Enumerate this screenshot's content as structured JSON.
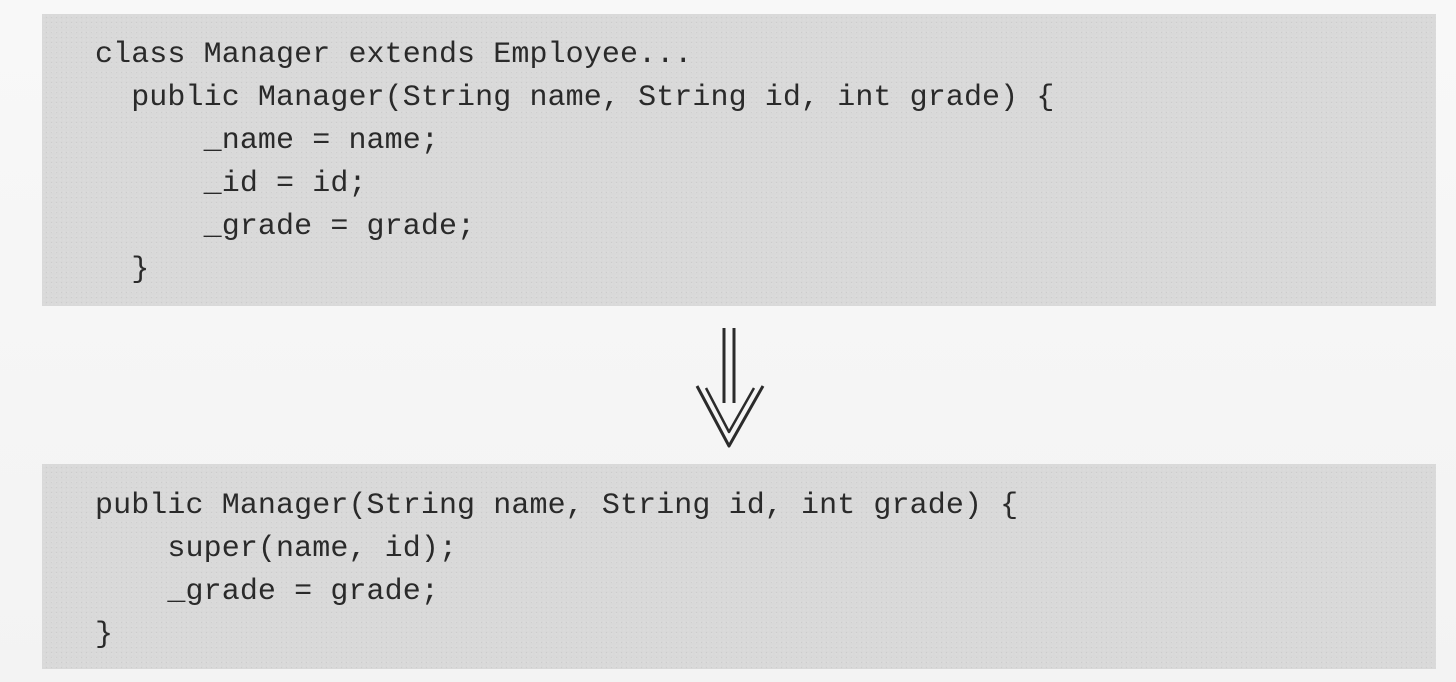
{
  "before_code": {
    "lines": [
      "class Manager extends Employee...",
      "  public Manager(String name, String id, int grade) {",
      "      _name = name;",
      "      _id = id;",
      "      _grade = grade;",
      "  }"
    ]
  },
  "transition": {
    "icon": "double-down-arrow-icon"
  },
  "after_code": {
    "lines": [
      "public Manager(String name, String id, int grade) {",
      "    super(name, id);",
      "    _grade = grade;",
      "}"
    ]
  }
}
